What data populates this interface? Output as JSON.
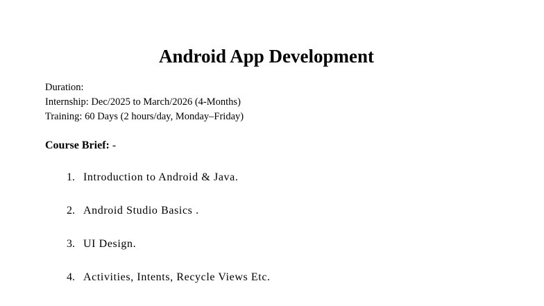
{
  "document": {
    "title": "Android App Development",
    "duration_label": "Duration:",
    "internship_label": "Internship",
    "internship_value": ": Dec/2025 to March/2026 (4-Months)",
    "training_label": "Training",
    "training_value": ": 60 Days (2 hours/day, Monday–Friday)",
    "course_brief_label": "Course Brief:",
    "course_brief_suffix": " -",
    "items": [
      {
        "num": "1.",
        "text": "Introduction to Android & Java."
      },
      {
        "num": "2.",
        "text": "Android Studio Basics ."
      },
      {
        "num": "3.",
        "text": "UI Design."
      },
      {
        "num": "4.",
        "text": "Activities, Intents, Recycle Views Etc."
      }
    ]
  }
}
